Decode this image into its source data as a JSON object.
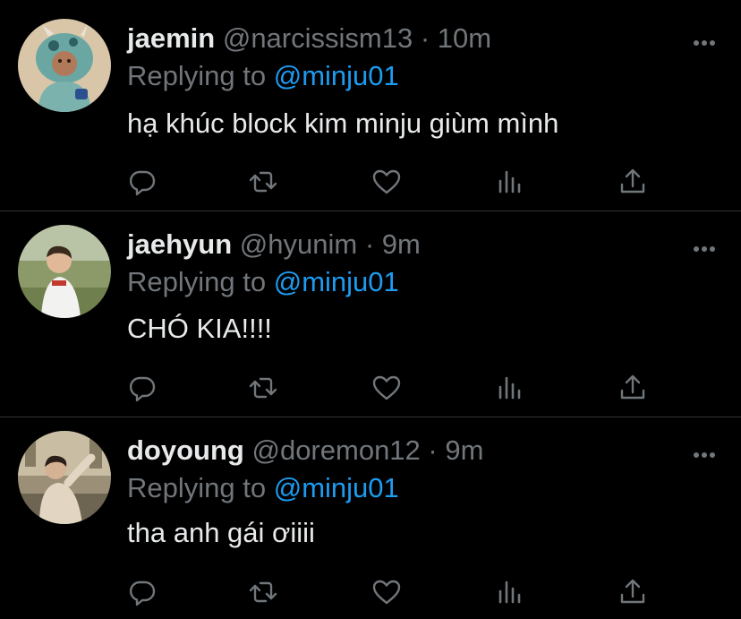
{
  "colors": {
    "background": "#000000",
    "divider": "#2f3336",
    "primary_text": "#e7e9ea",
    "secondary_text": "#71767b",
    "accent": "#1d9bf0"
  },
  "icons": {
    "reply": "reply-icon",
    "retweet": "retweet-icon",
    "like": "heart-icon",
    "analytics": "analytics-icon",
    "share": "share-icon",
    "more": "more-icon"
  },
  "tweets": [
    {
      "name": "jaemin",
      "handle": "@narcissism13",
      "dot": "·",
      "time": "10m",
      "replying_prefix": "Replying to",
      "replying_to": "@minju01",
      "text": "hạ khúc block kim minju giùm mình"
    },
    {
      "name": "jaehyun",
      "handle": "@hyunim",
      "dot": "·",
      "time": "9m",
      "replying_prefix": "Replying to",
      "replying_to": "@minju01",
      "text": "CHÓ KIA!!!!"
    },
    {
      "name": "doyoung",
      "handle": "@doremon12",
      "dot": "·",
      "time": "9m",
      "replying_prefix": "Replying to",
      "replying_to": "@minju01",
      "text": "tha anh gái ơiiii"
    }
  ]
}
